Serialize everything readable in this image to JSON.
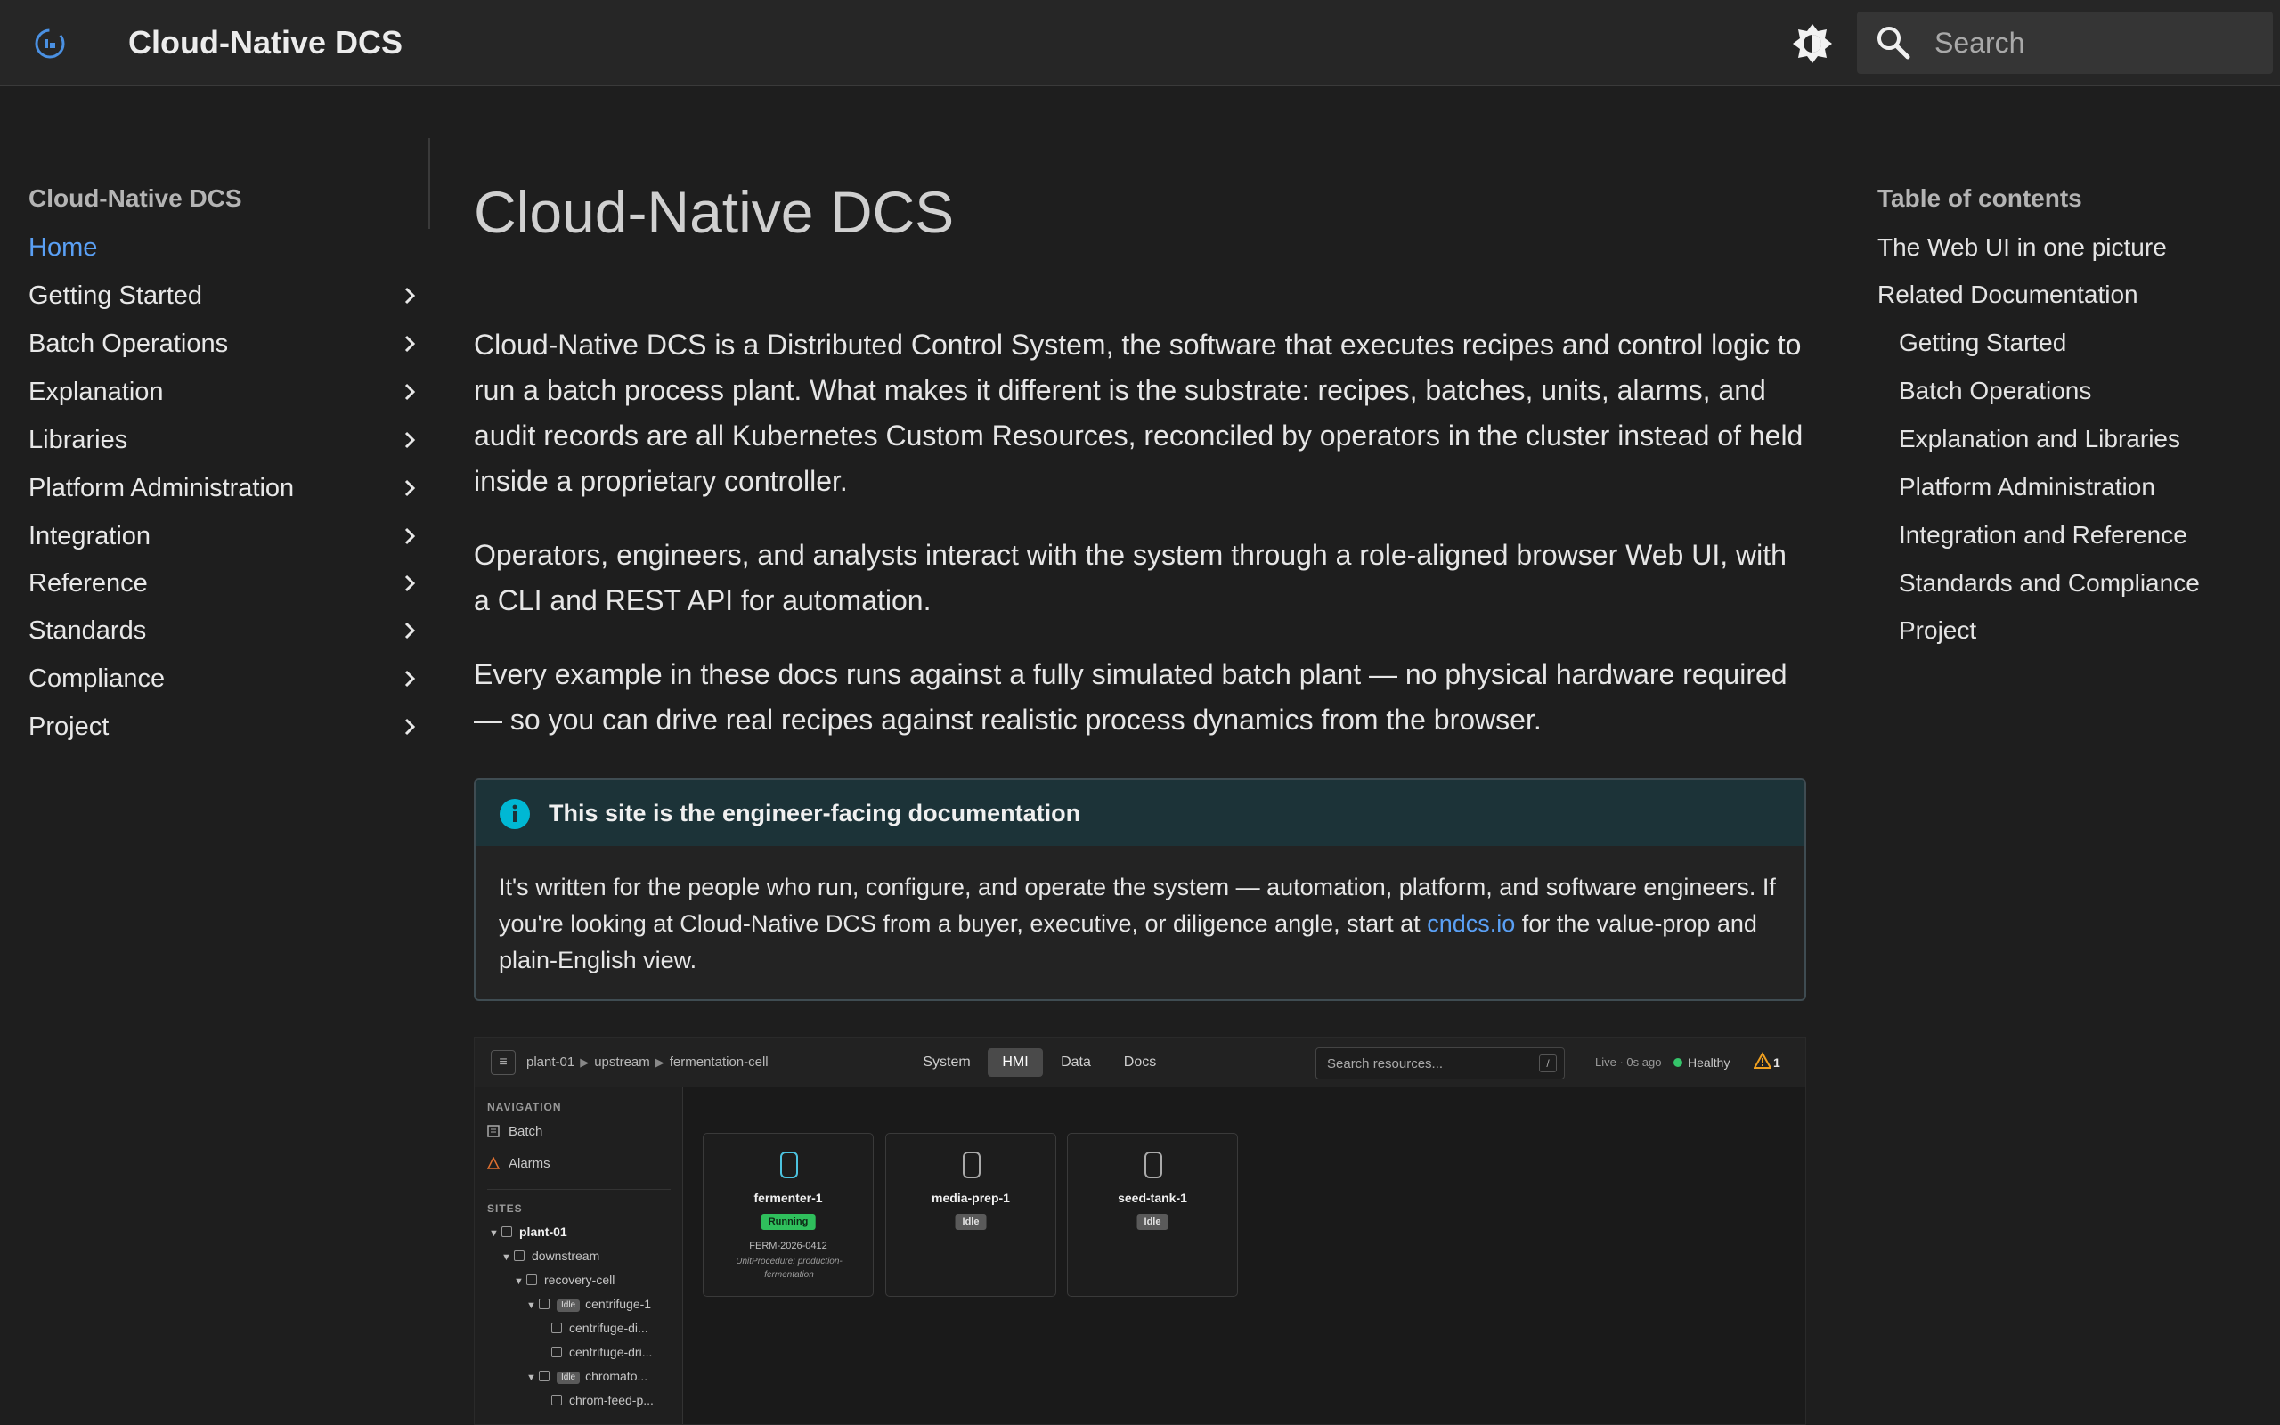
{
  "header": {
    "site_title": "Cloud-Native DCS",
    "search_placeholder": "Search",
    "logo_icon": "cloud-dcs-logo-icon",
    "theme_icon": "brightness-icon"
  },
  "nav": {
    "heading": "Cloud-Native DCS",
    "items": [
      {
        "label": "Home",
        "active": true
      },
      {
        "label": "Getting Started"
      },
      {
        "label": "Batch Operations"
      },
      {
        "label": "Explanation"
      },
      {
        "label": "Libraries"
      },
      {
        "label": "Platform Administration"
      },
      {
        "label": "Integration"
      },
      {
        "label": "Reference"
      },
      {
        "label": "Standards"
      },
      {
        "label": "Compliance"
      },
      {
        "label": "Project"
      }
    ]
  },
  "main": {
    "title": "Cloud-Native DCS",
    "paragraphs": [
      "Cloud-Native DCS is a Distributed Control System, the software that executes recipes and control logic to run a batch process plant. What makes it different is the substrate: recipes, batches, units, alarms, and audit records are all Kubernetes Custom Resources, reconciled by operators in the cluster instead of held inside a proprietary controller.",
      "Operators, engineers, and analysts interact with the system through a role-aligned browser Web UI, with a CLI and REST API for automation.",
      "Every example in these docs runs against a fully simulated batch plant — no physical hardware required — so you can drive real recipes against realistic process dynamics from the browser."
    ],
    "admonition": {
      "title": "This site is the engineer-facing documentation",
      "body_before": "It's written for the people who run, configure, and operate the system — automation, platform, and software engineers. If you're looking at Cloud-Native DCS from a buyer, executive, or diligence angle, start at ",
      "link": "cndcs.io",
      "body_after": " for the value-prop and plain-English view."
    }
  },
  "screenshot": {
    "breadcrumbs": [
      "plant-01",
      "upstream",
      "fermentation-cell"
    ],
    "tabs": [
      "System",
      "HMI",
      "Data",
      "Docs"
    ],
    "active_tab": "HMI",
    "search_placeholder": "Search resources...",
    "search_kbd": "/",
    "live": "Live · 0s ago",
    "health": "Healthy",
    "alarm_count": "1",
    "nav_heading": "NAVIGATION",
    "nav_items": [
      "Batch",
      "Alarms"
    ],
    "sites_heading": "SITES",
    "tree": {
      "plant": "plant-01",
      "area": "downstream",
      "cell": "recovery-cell",
      "badge": "Idle",
      "unit1": "centrifuge-1",
      "unit1_child1": "centrifuge-di...",
      "unit1_child2": "centrifuge-dri...",
      "unit2": "chromato...",
      "unit2_child1": "chrom-feed-p..."
    },
    "units": [
      {
        "name": "fermenter-1",
        "state": "Running",
        "batch": "FERM-2026-0412",
        "procedure": "UnitProcedure: production-fermentation"
      },
      {
        "name": "media-prep-1",
        "state": "Idle"
      },
      {
        "name": "seed-tank-1",
        "state": "Idle"
      }
    ]
  },
  "toc": {
    "heading": "Table of contents",
    "items": [
      {
        "label": "The Web UI in one picture",
        "level": 1
      },
      {
        "label": "Related Documentation",
        "level": 1
      },
      {
        "label": "Getting Started",
        "level": 2
      },
      {
        "label": "Batch Operations",
        "level": 2
      },
      {
        "label": "Explanation and Libraries",
        "level": 2
      },
      {
        "label": "Platform Administration",
        "level": 2
      },
      {
        "label": "Integration and Reference",
        "level": 2
      },
      {
        "label": "Standards and Compliance",
        "level": 2
      },
      {
        "label": "Project",
        "level": 2
      }
    ]
  },
  "colors": {
    "accent": "#5aa0f5",
    "running": "#2fbf5c",
    "info": "#00b8d4"
  }
}
